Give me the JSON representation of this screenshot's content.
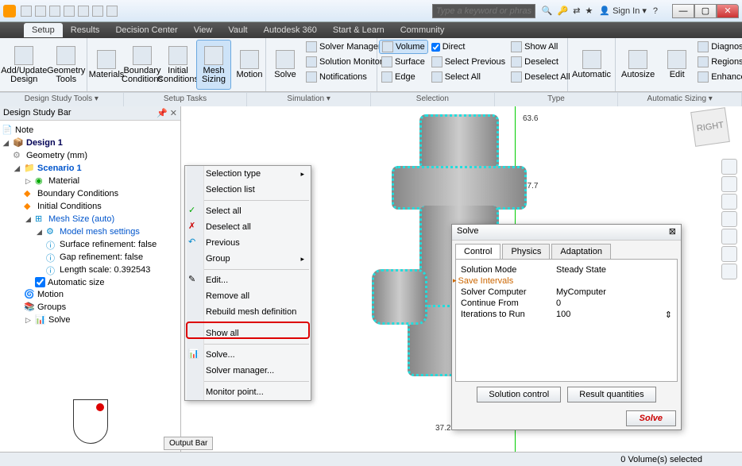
{
  "titlebar": {
    "search_placeholder": "Type a keyword or phrase",
    "signin": "Sign In"
  },
  "tabs": [
    "Setup",
    "Results",
    "Decision Center",
    "View",
    "Vault",
    "Autodesk 360",
    "Start & Learn",
    "Community"
  ],
  "active_tab": "Setup",
  "ribbon": {
    "add_update": "Add/Update Design",
    "geom_tools": "Geometry Tools",
    "materials": "Materials",
    "boundary": "Boundary Conditions",
    "initial": "Initial Conditions",
    "mesh": "Mesh Sizing",
    "motion": "Motion",
    "solve": "Solve",
    "solver_manager": "Solver Manager",
    "solution_monitor": "Solution Monitor",
    "notifications": "Notifications",
    "volume": "Volume",
    "surface": "Surface",
    "edge": "Edge",
    "direct": "Direct",
    "select_previous": "Select Previous",
    "select_all": "Select All",
    "show_all": "Show All",
    "deselect": "Deselect",
    "deselect_all": "Deselect All",
    "automatic": "Automatic",
    "autosize": "Autosize",
    "edit": "Edit",
    "diagnostics": "Diagnostics",
    "regions": "Regions",
    "enhancement": "Enhancement"
  },
  "panel_labels": {
    "design_tools": "Design Study Tools ▾",
    "setup_tasks": "Setup Tasks",
    "simulation": "Simulation ▾",
    "selection": "Selection",
    "type": "Type",
    "auto_sizing": "Automatic Sizing ▾"
  },
  "sidebar": {
    "title": "Design Study Bar",
    "note": "Note",
    "design": "Design 1",
    "geometry": "Geometry (mm)",
    "scenario": "Scenario 1",
    "material": "Material",
    "bc": "Boundary Conditions",
    "ic": "Initial Conditions",
    "mesh": "Mesh Size (auto)",
    "mms": "Model mesh settings",
    "surf_ref": "Surface refinement: false",
    "gap_ref": "Gap refinement: false",
    "len_scale": "Length scale: 0.392543",
    "auto_size": "Automatic size",
    "motion": "Motion",
    "groups": "Groups",
    "solve": "Solve"
  },
  "context_menu": {
    "sel_type": "Selection type",
    "sel_list": "Selection list",
    "sel_all": "Select all",
    "desel_all": "Deselect all",
    "previous": "Previous",
    "group": "Group",
    "edit": "Edit...",
    "remove": "Remove all",
    "rebuild": "Rebuild mesh definition",
    "show_all": "Show all",
    "solve": "Solve...",
    "solver_mgr": "Solver manager...",
    "monitor": "Monitor point..."
  },
  "dims": {
    "d1": "63.6",
    "d2": "47.7",
    "d3": "37.2"
  },
  "dialog": {
    "title": "Solve",
    "tabs": [
      "Control",
      "Physics",
      "Adaptation"
    ],
    "rows": {
      "mode_k": "Solution Mode",
      "mode_v": "Steady State",
      "save_k": "Save Intervals",
      "comp_k": "Solver Computer",
      "comp_v": "MyComputer",
      "cont_k": "Continue From",
      "cont_v": "0",
      "iter_k": "Iterations to Run",
      "iter_v": "100"
    },
    "btn1": "Solution control",
    "btn2": "Result quantities",
    "solve": "Solve"
  },
  "outbar": "Output Bar",
  "status": "0 Volume(s) selected",
  "viewcube": "RIGHT"
}
